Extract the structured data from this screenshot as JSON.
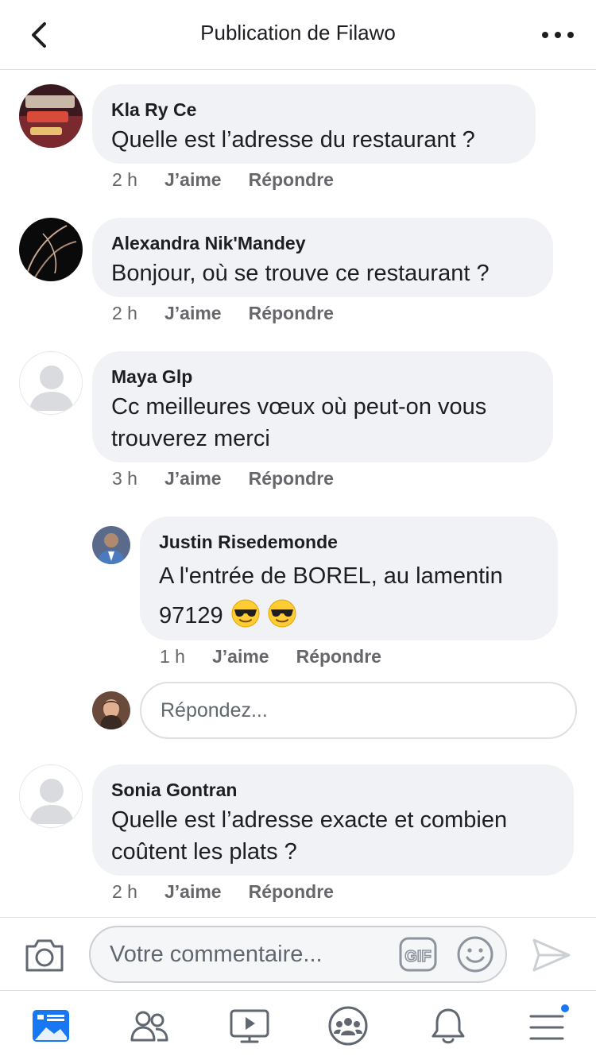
{
  "header": {
    "title": "Publication de Filawo"
  },
  "comments": [
    {
      "author": "Kla Ry Ce",
      "text": "Quelle est l’adresse du restaurant ?",
      "time": "2 h",
      "like": "J’aime",
      "reply": "Répondre"
    },
    {
      "author": "Alexandra Nik'Mandey",
      "text": "Bonjour, où se trouve ce restaurant ?",
      "time": "2 h",
      "like": "J’aime",
      "reply": "Répondre"
    },
    {
      "author": "Maya Glp",
      "text_line1": "Cc meilleures vœux où peut-on vous",
      "text_line2": "trouverez merci",
      "time": "3 h",
      "like": "J’aime",
      "reply": "Répondre"
    },
    {
      "author": "Justin Risedemonde",
      "text_line1": "A l'entrée de BOREL, au lamentin",
      "text_line2": "97129",
      "time": "1 h",
      "like": "J’aime",
      "reply": "Répondre"
    },
    {
      "author": "Sonia Gontran",
      "text_line1": "Quelle est l’adresse exacte et combien",
      "text_line2": "coûtent les plats ?",
      "time": "2 h",
      "like": "J’aime",
      "reply": "Répondre"
    }
  ],
  "reply_box": {
    "placeholder": "Répondez..."
  },
  "composer": {
    "placeholder": "Votre commentaire...",
    "gif_label": "GIF"
  },
  "colors": {
    "accent": "#1877f2",
    "bubble": "#f0f2f5",
    "meta": "#65676b"
  }
}
